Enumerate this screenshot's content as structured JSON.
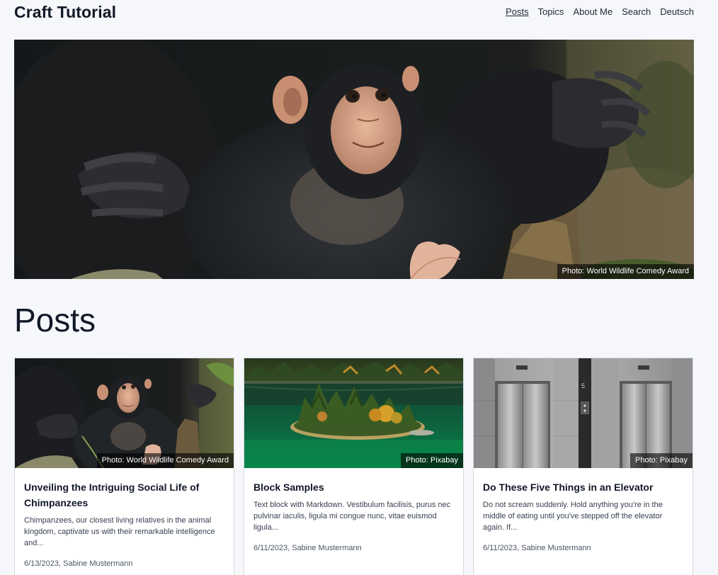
{
  "header": {
    "title": "Craft Tutorial",
    "nav": [
      "Posts",
      "Topics",
      "About Me",
      "Search",
      "Deutsch"
    ]
  },
  "hero": {
    "credit": "Photo: World Wildlife Comedy Award",
    "image": "baby-chimpanzee-photo"
  },
  "main": {
    "heading": "Posts"
  },
  "posts": [
    {
      "title": "Unveiling the Intriguing Social Life of Chimpanzees",
      "excerpt": "Chimpanzees, our closest living relatives in the animal kingdom, captivate us with their remarkable intelligence and...",
      "meta": "6/13/2023, Sabine Mustermann",
      "credit": "Photo: World Wildlife Comedy Award",
      "image": "baby-chimpanzee-photo"
    },
    {
      "title": "Block Samples",
      "excerpt": "Text block with Markdown. Vestibulum facilisis, purus nec pulvinar iaculis, ligula mi congue nunc, vitae euismod ligula...",
      "meta": "6/11/2023, Sabine Mustermann",
      "credit": "Photo: Pixabay",
      "image": "lake-island-photo"
    },
    {
      "title": "Do These Five Things in an Elevator",
      "excerpt": "Do not scream suddenly. Hold anything you're in the middle of eating until you've stepped off the elevator again. If...",
      "meta": "6/11/2023, Sabine Mustermann",
      "credit": "Photo: Pixabay",
      "image": "elevator-doors-photo"
    }
  ],
  "colors": {
    "background": "#f5f7fa",
    "text": "#111827",
    "card_border": "#d6dae0"
  }
}
